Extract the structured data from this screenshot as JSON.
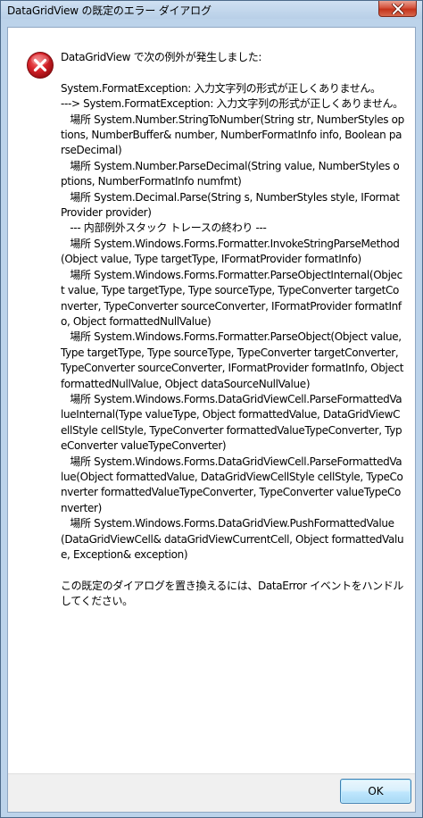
{
  "window": {
    "title": "DataGridView の既定のエラー ダイアログ"
  },
  "dialog": {
    "message": "DataGridView で次の例外が発生しました:\n\nSystem.FormatException: 入力文字列の形式が正しくありません。\n---> System.FormatException: 入力文字列の形式が正しくありません。\n   場所 System.Number.StringToNumber(String str, NumberStyles options, NumberBuffer& number, NumberFormatInfo info, Boolean parseDecimal)\n   場所 System.Number.ParseDecimal(String value, NumberStyles options, NumberFormatInfo numfmt)\n   場所 System.Decimal.Parse(String s, NumberStyles style, IFormatProvider provider)\n   --- 内部例外スタック トレースの終わり ---\n   場所 System.Windows.Forms.Formatter.InvokeStringParseMethod(Object value, Type targetType, IFormatProvider formatInfo)\n   場所 System.Windows.Forms.Formatter.ParseObjectInternal(Object value, Type targetType, Type sourceType, TypeConverter targetConverter, TypeConverter sourceConverter, IFormatProvider formatInfo, Object formattedNullValue)\n   場所 System.Windows.Forms.Formatter.ParseObject(Object value, Type targetType, Type sourceType, TypeConverter targetConverter, TypeConverter sourceConverter, IFormatProvider formatInfo, Object formattedNullValue, Object dataSourceNullValue)\n   場所 System.Windows.Forms.DataGridViewCell.ParseFormattedValueInternal(Type valueType, Object formattedValue, DataGridViewCellStyle cellStyle, TypeConverter formattedValueTypeConverter, TypeConverter valueTypeConverter)\n   場所 System.Windows.Forms.DataGridViewCell.ParseFormattedValue(Object formattedValue, DataGridViewCellStyle cellStyle, TypeConverter formattedValueTypeConverter, TypeConverter valueTypeConverter)\n   場所 System.Windows.Forms.DataGridView.PushFormattedValue(DataGridViewCell& dataGridViewCurrentCell, Object formattedValue, Exception& exception)\n\nこの既定のダイアログを置き換えるには、DataError イベントをハンドルしてください。",
    "icon": "error-icon",
    "ok_label": "OK"
  },
  "colors": {
    "frame": "#bcd3ea",
    "close_button": "#c4331b",
    "error_red": "#c8141c",
    "ok_border": "#3c7fb1",
    "footer_bg": "#f0f0f0"
  }
}
